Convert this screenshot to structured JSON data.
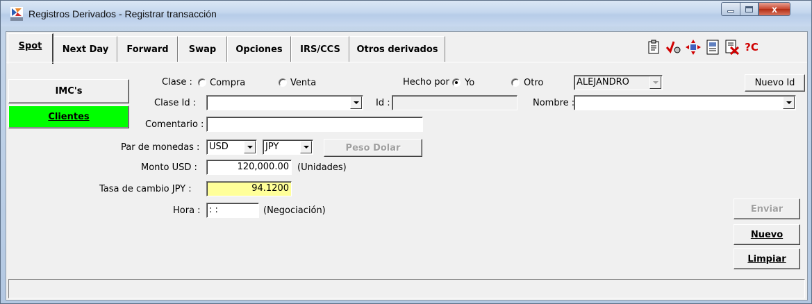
{
  "window": {
    "title": "Registros Derivados - Registrar transacción",
    "close_glyph": "x"
  },
  "tabs": [
    {
      "label": "Spot"
    },
    {
      "label": "Next Day"
    },
    {
      "label": "Forward"
    },
    {
      "label": "Swap"
    },
    {
      "label": "Opciones"
    },
    {
      "label": "IRS/CCS"
    },
    {
      "label": "Otros derivados"
    }
  ],
  "toolbar_icons": [
    "clipboard-icon",
    "check-icon",
    "move-icon",
    "document-icon",
    "cancel-document-icon",
    "help-icon"
  ],
  "toolbar_help_glyph": "?C",
  "left_buttons": {
    "imcs": "IMC's",
    "clientes": "Clientes"
  },
  "form": {
    "clase_label": "Clase :",
    "compra_label": "Compra",
    "venta_label": "Venta",
    "hecho_por_label": "Hecho por :",
    "yo_label": "Yo",
    "otro_label": "Otro",
    "user_value": "ALEJANDRO",
    "nuevo_id_label": "Nuevo Id",
    "clase_id_label": "Clase Id :",
    "clase_id_value": "",
    "id_label": "Id :",
    "id_value": "",
    "nombre_label": "Nombre :",
    "nombre_value": "",
    "comentario_label": "Comentario :",
    "comentario_value": "",
    "par_monedas_label": "Par de monedas :",
    "currency_1": "USD",
    "currency_2": "JPY",
    "peso_dolar_label": "Peso Dolar",
    "monto_label": "Monto USD :",
    "monto_value": "120,000.00",
    "monto_unit": "(Unidades)",
    "tasa_label": "Tasa de cambio JPY :",
    "tasa_value": "94.1200",
    "hora_label": "Hora :",
    "hora_value": " :  : ",
    "hora_unit": "(Negociación)"
  },
  "action_buttons": {
    "enviar": "Enviar",
    "nuevo": "Nuevo",
    "limpiar": "Limpiar"
  },
  "status_text": "",
  "colors": {
    "clientes_button": "#00ff00",
    "tasa_field": "#ffff99"
  }
}
